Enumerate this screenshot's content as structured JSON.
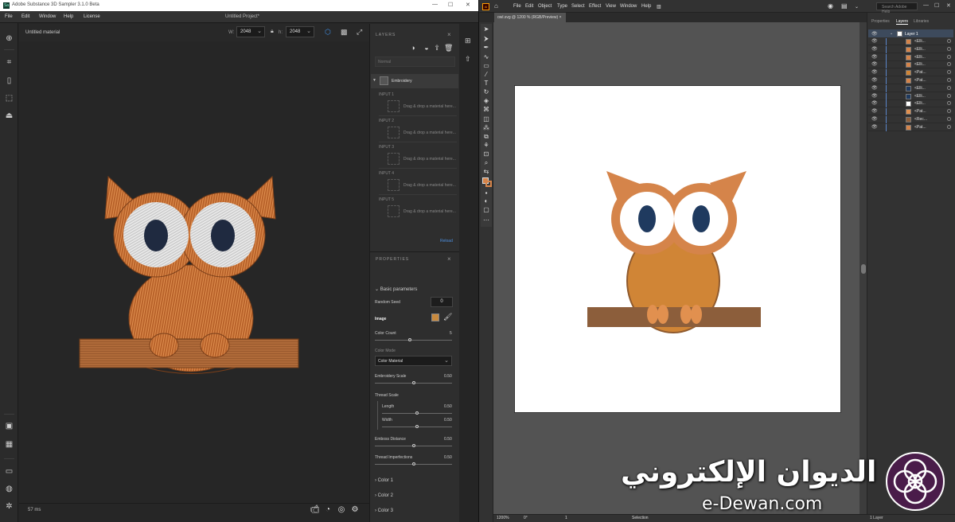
{
  "sampler": {
    "title": "Adobe Substance 3D Sampler 3.1.0 Beta",
    "logo": "Sa",
    "menu": [
      "File",
      "Edit",
      "Window",
      "Help",
      "License"
    ],
    "project": "Untitled Project*",
    "material_name": "Untitled material",
    "width_label": "W:",
    "width_value": "2048",
    "height_label": "h:",
    "height_value": "2048",
    "frame_time": "57 ms",
    "layers": {
      "header": "LAYERS",
      "blend_mode": "Normal",
      "layer_name": "Embroidery",
      "inputs": [
        {
          "label": "INPUT 1",
          "drop": "Drag & drop a material here..."
        },
        {
          "label": "INPUT 2",
          "drop": "Drag & drop a material here..."
        },
        {
          "label": "INPUT 3",
          "drop": "Drag & drop a material here..."
        },
        {
          "label": "INPUT 4",
          "drop": "Drag & drop a material here..."
        },
        {
          "label": "INPUT 5",
          "drop": "Drag & drop a material here..."
        }
      ],
      "reload": "Reload"
    },
    "properties": {
      "header": "PROPERTIES",
      "section": "Basic parameters",
      "random_seed_label": "Random Seed",
      "random_seed": "0",
      "image_label": "Image",
      "color_count_label": "Color Count",
      "color_count": "5",
      "color_mode_label": "Color Mode",
      "color_mode": "Color Material",
      "embroidery_scale_label": "Embroidery Scale",
      "embroidery_scale": "0.50",
      "thread_scale_label": "Thread Scale",
      "length_label": "Length",
      "length": "0.50",
      "width_label": "Width",
      "width": "0.50",
      "emboss_label": "Emboss Distance",
      "emboss": "0.50",
      "imperfections_label": "Thread Imperfections",
      "imperfections": "0.50",
      "color_sections": [
        "Color 1",
        "Color 2",
        "Color 3"
      ]
    }
  },
  "illustrator": {
    "logo": "Ai",
    "menu": [
      "File",
      "Edit",
      "Object",
      "Type",
      "Select",
      "Effect",
      "View",
      "Window",
      "Help"
    ],
    "search_placeholder": "Search Adobe Help",
    "doc_tab": "owl.svg @ 1200 % (RGB/Preview)",
    "status": {
      "zoom": "1200%",
      "angle": "0°",
      "artboard": "1",
      "tool": "Selection"
    },
    "panel_tabs": [
      "Properties",
      "Layers",
      "Libraries"
    ],
    "layer_name": "Layer 1",
    "sublayers": [
      "<Elli...",
      "<Elli...",
      "<Elli...",
      "<Elli...",
      "<Pat...",
      "<Pat...",
      "<Elli...",
      "<Elli...",
      "<Elli...",
      "<Pat...",
      "<Rec...",
      "<Pat..."
    ],
    "layer_count": "1 Layer"
  },
  "owl_colors": {
    "body": "#d08536",
    "ring": "#d5844a",
    "eye_white": "#ffffff",
    "pupil": "#1f3a5f",
    "branch": "#8c5e3b",
    "dark_outline": "#8f5a2e"
  },
  "watermark": {
    "arabic": "الديوان الإلكتروني",
    "url": "e-Dewan.com"
  }
}
